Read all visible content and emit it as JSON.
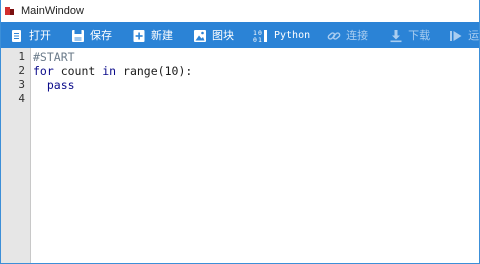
{
  "window": {
    "title": "MainWindow"
  },
  "toolbar": {
    "buttons": [
      {
        "label": "打开",
        "icon": "open-file-icon",
        "enabled": true
      },
      {
        "label": "保存",
        "icon": "save-icon",
        "enabled": true
      },
      {
        "label": "新建",
        "icon": "new-file-icon",
        "enabled": true
      },
      {
        "label": "图块",
        "icon": "blocks-image-icon",
        "enabled": true,
        "active": true
      },
      {
        "label": "Python",
        "icon": "python-code-icon",
        "enabled": true,
        "active": true
      },
      {
        "label": "连接",
        "icon": "link-icon",
        "enabled": false
      },
      {
        "label": "下载",
        "icon": "download-icon",
        "enabled": false
      },
      {
        "label": "运行",
        "icon": "run-icon",
        "enabled": false
      }
    ]
  },
  "editor": {
    "line_numbers": [
      "1",
      "2",
      "3",
      "4"
    ],
    "lines": {
      "l1": {
        "comment": "#START"
      },
      "l2": {
        "kw_for": "for",
        "var": " count ",
        "kw_in": "in",
        "call": " range(",
        "num": "10",
        "close": "):"
      },
      "l3": {
        "indent": "  ",
        "kw_pass": "pass"
      }
    }
  },
  "colors": {
    "toolbar": "#2b83d6",
    "accent_underline": "#e2463b",
    "gutter": "#e6e6e6"
  }
}
